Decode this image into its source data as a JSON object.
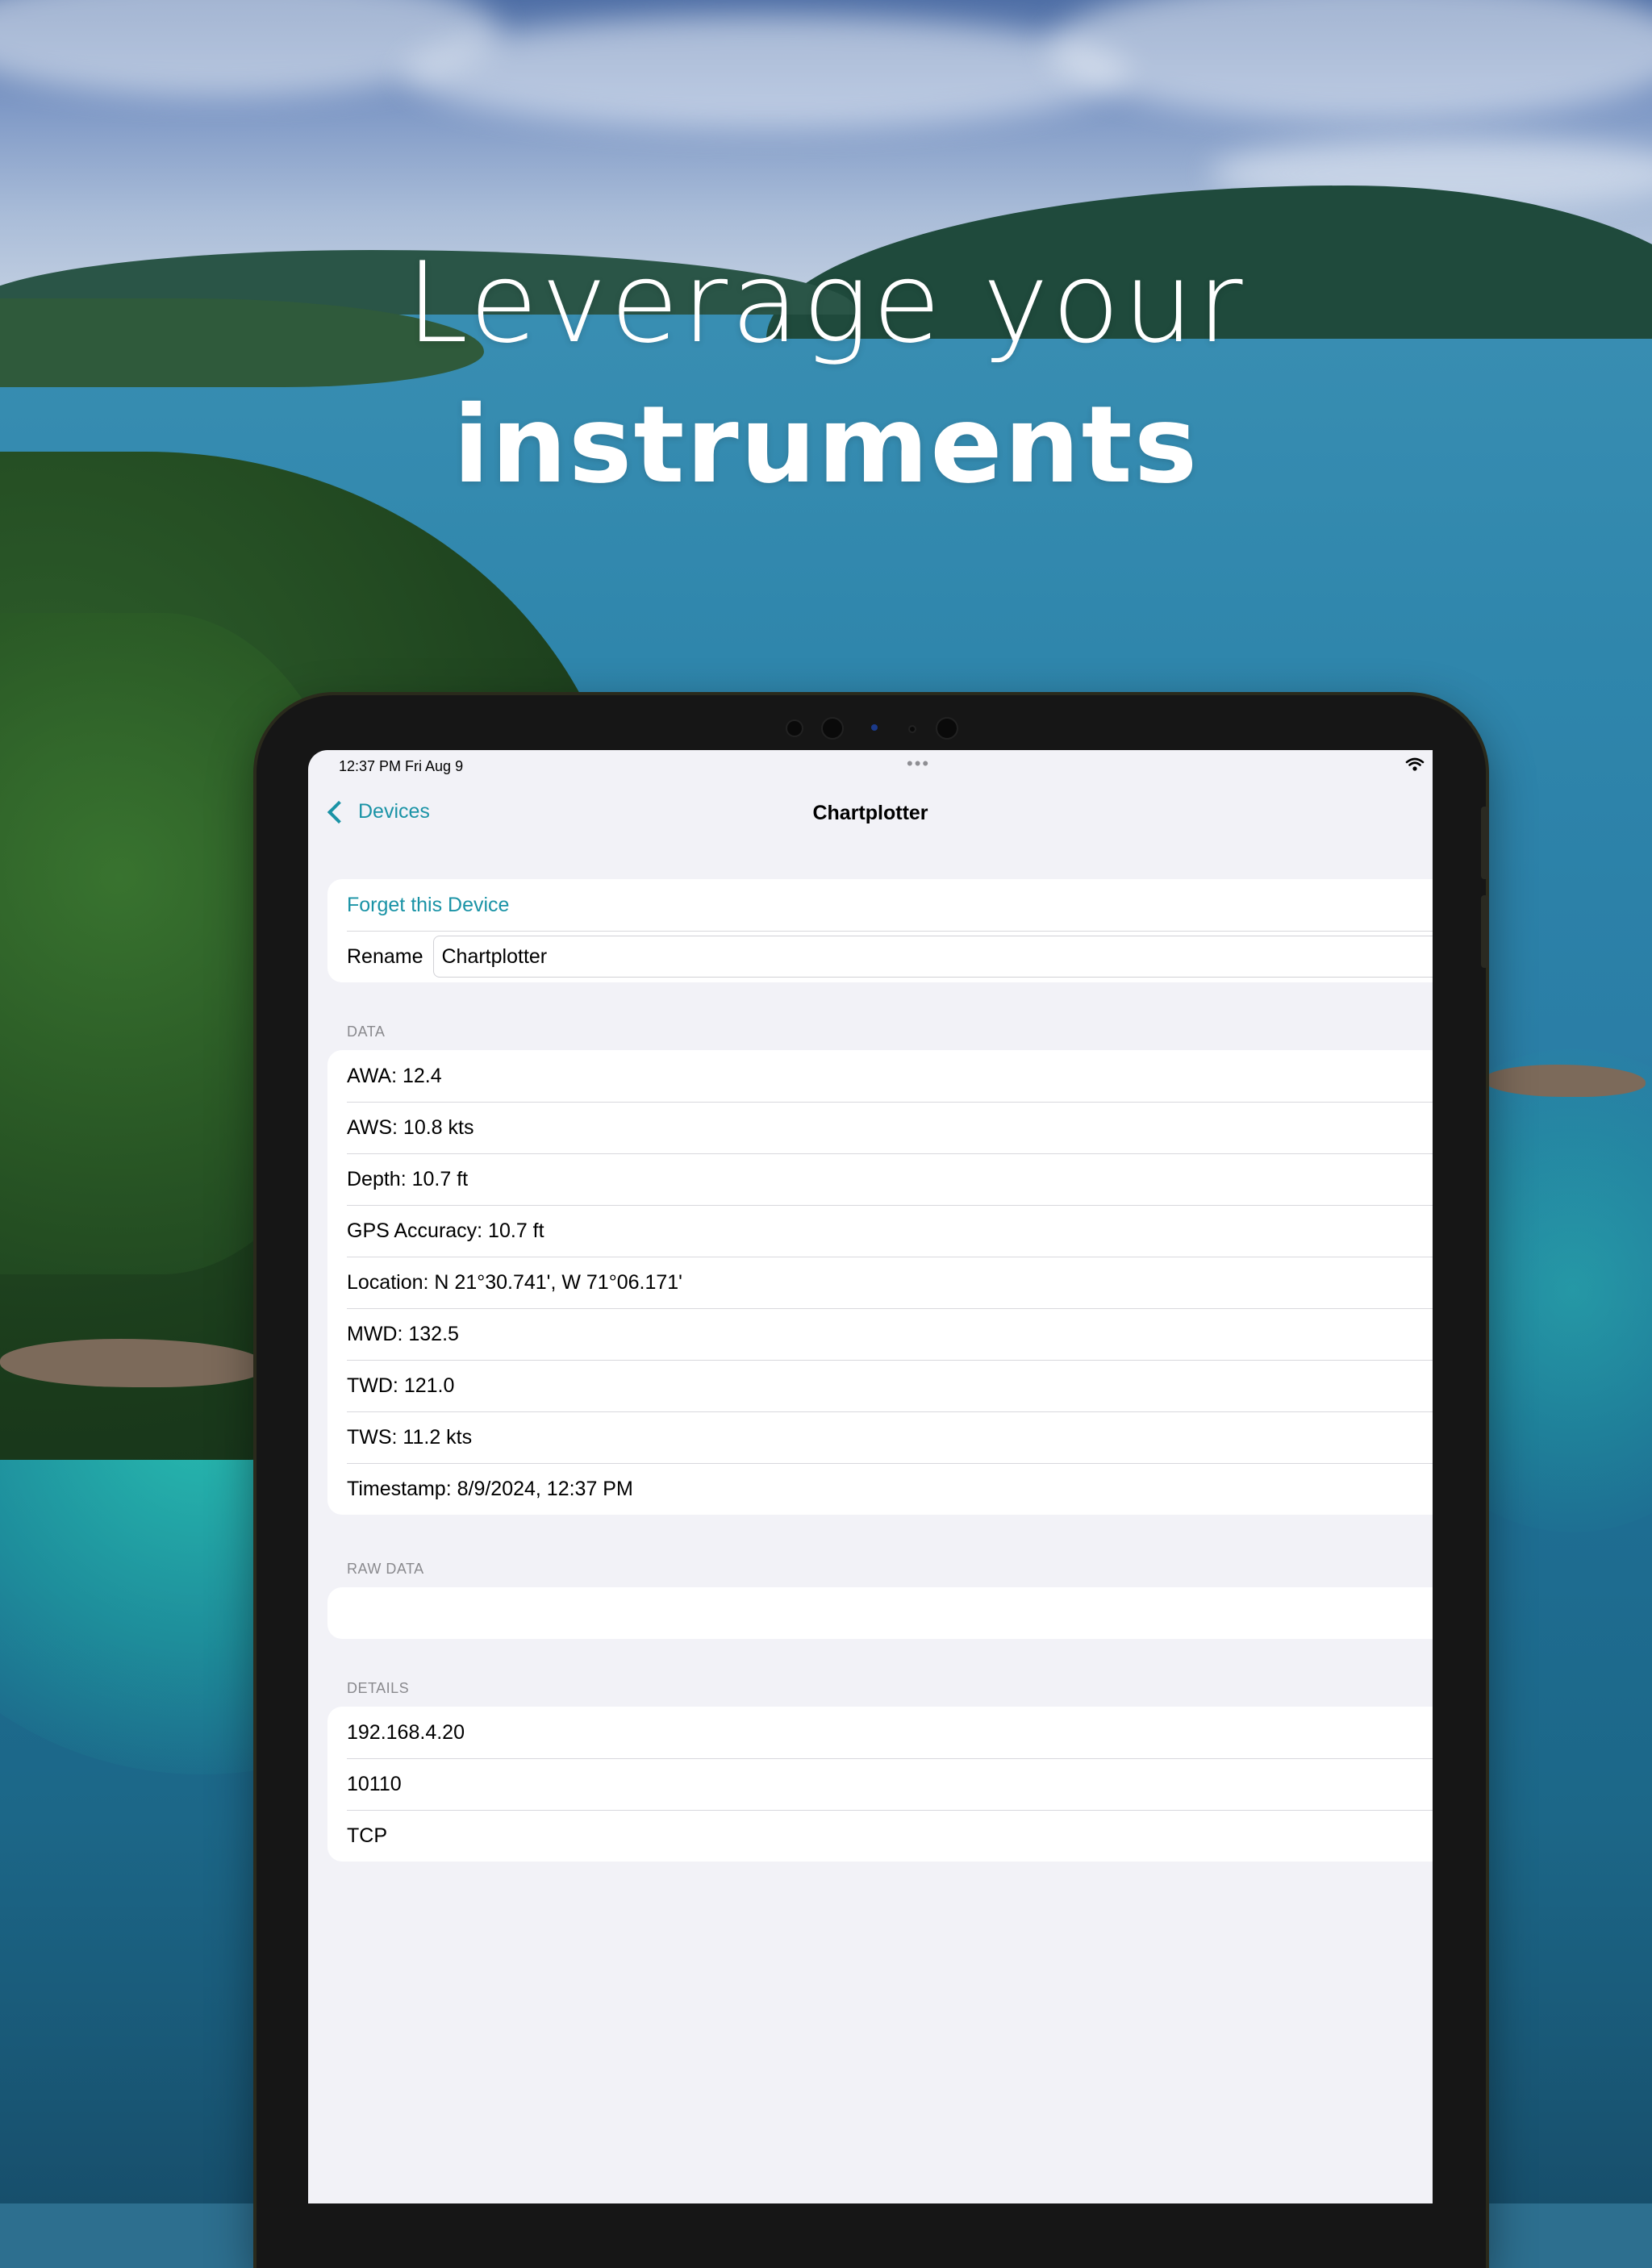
{
  "headline": {
    "line1": "Leverage your",
    "line2": "instruments"
  },
  "status_bar": {
    "time": "12:37 PM   Fri Aug 9",
    "multitask": "•••"
  },
  "nav": {
    "back_label": "Devices",
    "title": "Chartplotter"
  },
  "device_actions": {
    "forget_label": "Forget this Device",
    "rename_label": "Rename",
    "rename_value": "Chartplotter"
  },
  "data_section": {
    "header": "DATA",
    "rows": [
      "AWA: 12.4",
      "AWS: 10.8 kts",
      "Depth: 10.7 ft",
      "GPS Accuracy: 10.7 ft",
      "Location: N 21°30.741', W 71°06.171'",
      "MWD: 132.5",
      "TWD: 121.0",
      "TWS: 11.2 kts",
      "Timestamp: 8/9/2024, 12:37 PM"
    ]
  },
  "raw_section": {
    "header": "RAW DATA",
    "value": ""
  },
  "details_section": {
    "header": "DETAILS",
    "rows": [
      "192.168.4.20",
      "10110",
      "TCP"
    ]
  },
  "colors": {
    "accent": "#1a93a6",
    "list_bg": "#f2f2f7",
    "cell_bg": "#ffffff"
  }
}
